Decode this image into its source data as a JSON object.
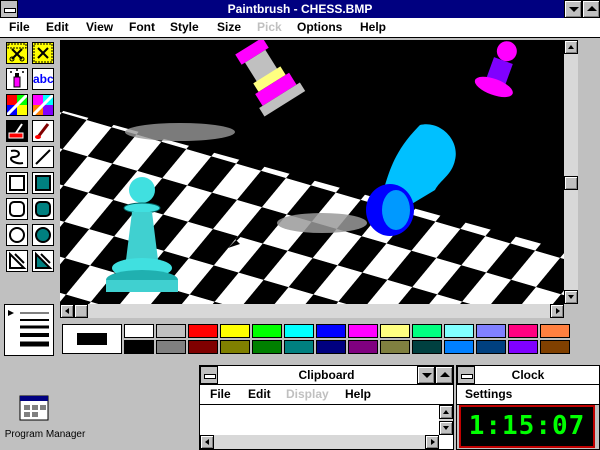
{
  "paintbrush": {
    "title": "Paintbrush - CHESS.BMP",
    "menu": [
      "File",
      "Edit",
      "View",
      "Font",
      "Style",
      "Size",
      "Pick",
      "Options",
      "Help"
    ],
    "menu_disabled": [
      "Pick"
    ],
    "tools": [
      {
        "name": "scissors-icon"
      },
      {
        "name": "pick-scissors-icon"
      },
      {
        "name": "airbrush-icon"
      },
      {
        "name": "text-tool-icon",
        "label": "abc"
      },
      {
        "name": "color-eraser-icon"
      },
      {
        "name": "eraser-icon"
      },
      {
        "name": "paint-roller-icon"
      },
      {
        "name": "brush-icon"
      },
      {
        "name": "curve-icon"
      },
      {
        "name": "line-icon"
      },
      {
        "name": "box-icon"
      },
      {
        "name": "filled-box-icon"
      },
      {
        "name": "rounded-box-icon"
      },
      {
        "name": "filled-rounded-box-icon"
      },
      {
        "name": "circle-icon"
      },
      {
        "name": "filled-circle-icon"
      },
      {
        "name": "polygon-icon"
      },
      {
        "name": "filled-polygon-icon"
      }
    ],
    "palette": {
      "top": [
        "#ffffff",
        "#c0c0c0",
        "#ff0000",
        "#ffff00",
        "#00ff00",
        "#00ffff",
        "#0000ff",
        "#ff00ff",
        "#ffff80",
        "#00ff80",
        "#80ffff",
        "#8080ff",
        "#ff0080",
        "#ff8040"
      ],
      "bottom": [
        "#000000",
        "#808080",
        "#800000",
        "#808000",
        "#008000",
        "#008080",
        "#000080",
        "#800080",
        "#808040",
        "#004040",
        "#0080ff",
        "#004080",
        "#8000ff",
        "#804000"
      ],
      "foreground": "#000000",
      "background": "#ffffff"
    }
  },
  "clipboard": {
    "title": "Clipboard",
    "menu": [
      "File",
      "Edit",
      "Display",
      "Help"
    ],
    "menu_disabled": [
      "Display"
    ]
  },
  "clock": {
    "title": "Clock",
    "menu": [
      "Settings"
    ],
    "time": "1:15:07"
  },
  "desktop": {
    "program_manager_label": "Program Manager"
  }
}
